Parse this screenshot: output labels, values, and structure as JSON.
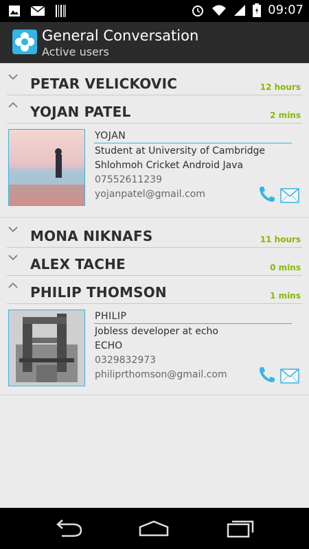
{
  "status_bar": {
    "time": "09:07",
    "icons": [
      "gallery-icon",
      "mail-icon",
      "barcode-icon",
      "alarm-icon",
      "wifi-icon",
      "signal-icon",
      "battery-icon"
    ]
  },
  "action_bar": {
    "title": "General Conversation",
    "subtitle": "Active users",
    "app_icon": "app-logo-icon"
  },
  "colors": {
    "accent": "#33b5e5",
    "time_green": "#8ab800",
    "action_bar_bg": "#2b2b2b",
    "list_bg": "#ebebeb"
  },
  "groups": [
    {
      "name": "PETAR VELICKOVIC",
      "time": "12 hours",
      "expanded": false
    },
    {
      "name": "YOJAN PATEL",
      "time": "2 mins",
      "expanded": true,
      "details": {
        "name": "YOJAN",
        "line1": "Student at University of Cambridge",
        "line2": "Shlohmoh Cricket Android Java",
        "phone": "07552611239",
        "email": "yojanpatel@gmail.com"
      }
    },
    {
      "name": "MONA NIKNAFS",
      "time": "11 hours",
      "expanded": false
    },
    {
      "name": "ALEX TACHE",
      "time": "0 mins",
      "expanded": false
    },
    {
      "name": "PHILIP THOMSON",
      "time": "1 mins",
      "expanded": true,
      "details": {
        "name": "PHILIP",
        "line1": "Jobless developer at echo",
        "line2": "ECHO",
        "phone": "0329832973",
        "email": "philiprthomson@gmail.com"
      }
    }
  ],
  "nav_bar": {
    "buttons": [
      "back-icon",
      "home-icon",
      "recent-apps-icon"
    ]
  }
}
